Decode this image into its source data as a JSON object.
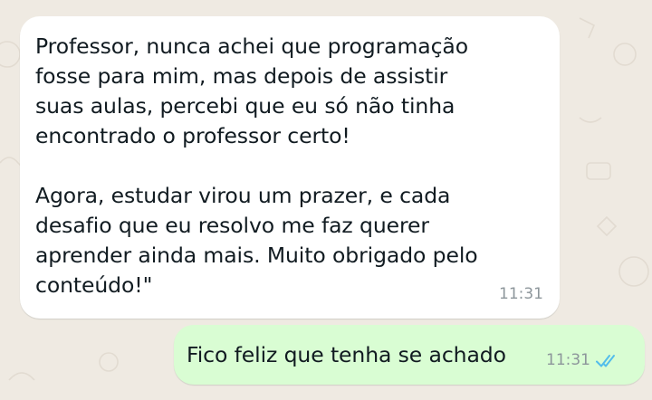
{
  "chat": {
    "messages": [
      {
        "direction": "incoming",
        "text": "Professor, nunca achei que programação\nfosse para mim, mas depois de assistir\nsuas aulas, percebi que eu só não tinha\nencontrado o professor certo!\n\nAgora, estudar virou um prazer, e cada\ndesafio que eu resolvo me faz querer\naprender ainda mais. Muito obrigado pelo\nconteúdo!\"",
        "time": "11:31"
      },
      {
        "direction": "outgoing",
        "text": "Fico feliz que tenha se achado",
        "time": "11:31",
        "status": "read",
        "status_icon": "double-check-icon"
      }
    ]
  },
  "colors": {
    "background": "#efeae2",
    "incoming_bubble": "#ffffff",
    "outgoing_bubble": "#d9fdd3",
    "read_ticks": "#53bdeb",
    "timestamp": "#8d969b"
  }
}
